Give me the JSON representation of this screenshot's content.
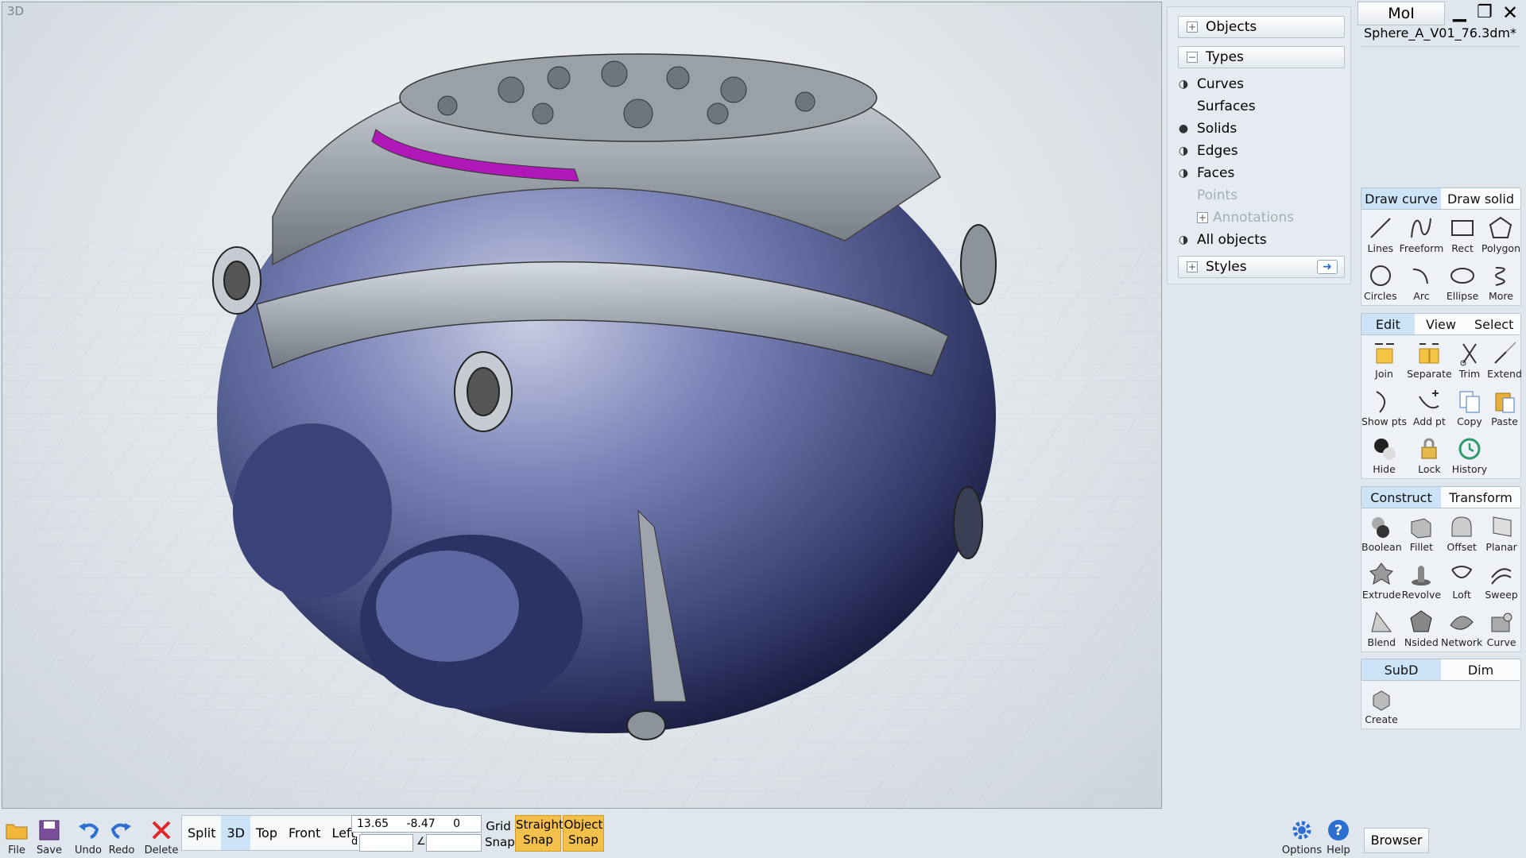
{
  "viewport": {
    "label": "3D"
  },
  "app": {
    "name": "MoI",
    "file": "Sphere_A_V01_76.3dm*"
  },
  "scene": {
    "objects_label": "Objects",
    "types_label": "Types",
    "types": [
      {
        "label": "Curves",
        "eye": "half"
      },
      {
        "label": "Surfaces",
        "eye": "none"
      },
      {
        "label": "Solids",
        "eye": "full"
      },
      {
        "label": "Edges",
        "eye": "half"
      },
      {
        "label": "Faces",
        "eye": "half"
      },
      {
        "label": "Points",
        "eye": "none",
        "disabled": true
      },
      {
        "label": "Annotations",
        "eye": "none",
        "disabled": true
      },
      {
        "label": "All objects",
        "eye": "half"
      }
    ],
    "styles_label": "Styles"
  },
  "draw": {
    "tabs": [
      "Draw curve",
      "Draw solid"
    ],
    "tools": [
      "Lines",
      "Freeform",
      "Rect",
      "Polygon",
      "Circles",
      "Arc",
      "Ellipse",
      "More"
    ]
  },
  "edit": {
    "tabs": [
      "Edit",
      "View",
      "Select"
    ],
    "tools": [
      "Join",
      "Separate",
      "Trim",
      "Extend",
      "Show pts",
      "Add pt",
      "Copy",
      "Paste",
      "Hide",
      "Lock",
      "History"
    ]
  },
  "construct": {
    "tabs": [
      "Construct",
      "Transform"
    ],
    "tools": [
      "Boolean",
      "Fillet",
      "Offset",
      "Planar",
      "Extrude",
      "Revolve",
      "Loft",
      "Sweep",
      "Blend",
      "Nsided",
      "Network",
      "Curve"
    ]
  },
  "subd": {
    "tabs": [
      "SubD",
      "Dim"
    ],
    "tools": [
      "Create"
    ]
  },
  "bottom": {
    "file": "File",
    "save": "Save",
    "undo": "Undo",
    "redo": "Redo",
    "delete": "Delete",
    "views": [
      "Split",
      "3D",
      "Top",
      "Front",
      "Left"
    ],
    "x": "13.65",
    "y": "-8.47",
    "z": "0",
    "d_label": "d",
    "angle_label": "∠",
    "grid_snap": "Grid Snap",
    "straight_snap": "Straight Snap",
    "object_snap": "Object Snap",
    "options": "Options",
    "help": "Help",
    "browser": "Browser"
  },
  "colors": {
    "accent": "#cde3f8",
    "snap": "#f4c04c",
    "model": "#5c6aa3",
    "metal": "#b8bec6",
    "highlight": "#b019b8"
  }
}
